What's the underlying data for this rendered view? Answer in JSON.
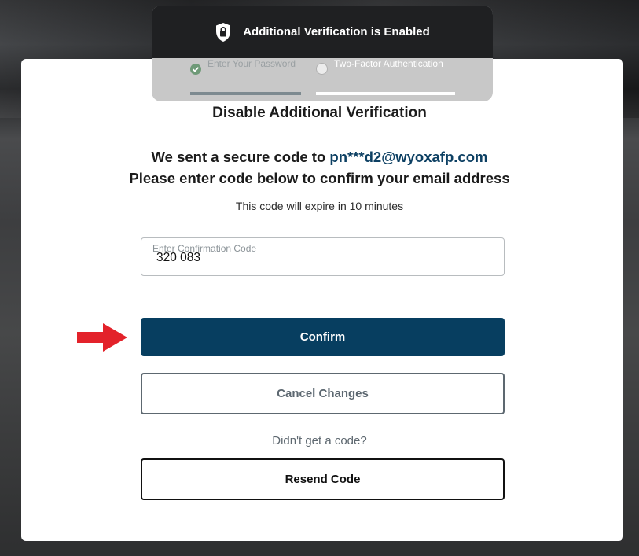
{
  "banner": {
    "title": "Additional Verification is Enabled",
    "steps": [
      {
        "label": "Enter Your Password",
        "state": "completed"
      },
      {
        "label": "Two-Factor Authentication",
        "state": "active"
      }
    ]
  },
  "modal": {
    "title": "Disable Additional Verification",
    "line1_prefix": "We sent a secure code to",
    "email": "pn***d2@wyoxafp.com",
    "line2": "Please enter code below to confirm your email address",
    "expire_text": "This code will expire in 10 minutes",
    "code_field": {
      "label": "Enter Confirmation Code",
      "value": "320 083"
    },
    "confirm_label": "Confirm",
    "cancel_label": "Cancel Changes",
    "no_code_text": "Didn't get a code?",
    "resend_label": "Resend Code"
  },
  "colors": {
    "primary": "#073e60",
    "email": "#0d4063",
    "arrow": "#e3222a",
    "banner_dark": "#1f2022",
    "step_check": "#6f9a78"
  },
  "icons": [
    "lock-shield-icon",
    "check-circle-icon",
    "empty-circle-icon",
    "red-arrow-icon"
  ]
}
